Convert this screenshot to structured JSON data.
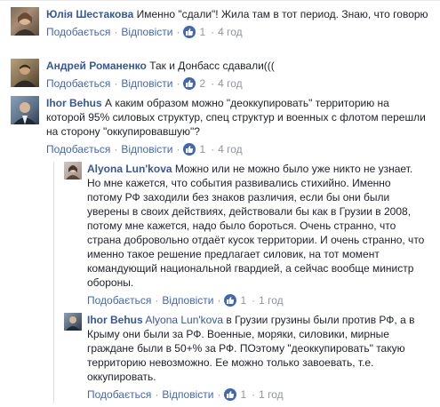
{
  "comments": [
    {
      "author": "Юлія Шестакова",
      "text": "Именно \"сдали\"! Жила там в тот период. Знаю, что говорю",
      "like_label": "Подобається",
      "reply_label": "Відповісти",
      "likes": "1",
      "time": "4 год"
    },
    {
      "author": "Андрей Романенко",
      "text": "Так и Донбасс сдавали(((",
      "like_label": "Подобається",
      "reply_label": "Відповісти",
      "likes": "2",
      "time": "4 год"
    },
    {
      "author": "Ihor Behus",
      "text": "А каким образом можно \"деоккупировать\" территорию на которой 95% силовых структур, спец структур и военных с флотом перешли на сторону \"оккупировавшую\"?",
      "like_label": "Подобається",
      "reply_label": "Відповісти",
      "likes": "1",
      "time": "4 год"
    }
  ],
  "replies": [
    {
      "author": "Alyona Lun'kova",
      "text": "Можно или не можно было уже никто не узнает. Но мне кажется, что события развивались стихийно. Именно потому РФ заходили без знаков различия, если бы они были уверены в своих действиях, действовали бы как в Грузии в 2008, потому мне кажется, надо было бороться. Очень странно, что страна добровольно отдаёт кусок территории. И очень странно, что именно такое решение предлагает силовик, на тот момент командующий национальной гвардией, а сейчас вообще министр обороны.",
      "like_label": "Подобається",
      "reply_label": "Відповісти",
      "likes": "1",
      "time": "1 год"
    },
    {
      "author": "Ihor Behus",
      "mention": "Alyona Lun'kova",
      "text": "в Грузии грузины были против РФ, а в Крыму они были за РФ. Военные, моряки, силовики, мирные граждане были в 50+% за РФ. ПОэтому \"деоккупировать\" такую территорию невозможно. Ее можно только завоевать, т.е. оккупировать.",
      "like_label": "Подобається",
      "reply_label": "Відповісти",
      "likes": "1",
      "time": "1 год"
    }
  ],
  "colors": {
    "link": "#365899",
    "action": "#4267b2",
    "meta": "#90949c",
    "text": "#1d2129"
  },
  "icons": {
    "like_badge": "thumbs-up-icon"
  }
}
